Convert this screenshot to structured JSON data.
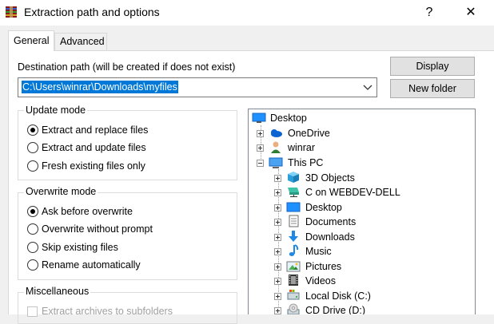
{
  "window": {
    "title": "Extraction path and options",
    "help_label": "?",
    "close_label": "✕"
  },
  "tabs": [
    {
      "label": "General",
      "active": true
    },
    {
      "label": "Advanced",
      "active": false
    }
  ],
  "destination": {
    "label": "Destination path (will be created if does not exist)",
    "value": "C:\\Users\\winrar\\Downloads\\myfiles"
  },
  "buttons": {
    "display": "Display",
    "new_folder": "New folder"
  },
  "update_mode": {
    "label": "Update mode",
    "options": [
      {
        "label": "Extract and replace files",
        "selected": true
      },
      {
        "label": "Extract and update files",
        "selected": false
      },
      {
        "label": "Fresh existing files only",
        "selected": false
      }
    ]
  },
  "overwrite_mode": {
    "label": "Overwrite mode",
    "options": [
      {
        "label": "Ask before overwrite",
        "selected": true
      },
      {
        "label": "Overwrite without prompt",
        "selected": false
      },
      {
        "label": "Skip existing files",
        "selected": false
      },
      {
        "label": "Rename automatically",
        "selected": false
      }
    ]
  },
  "miscellaneous": {
    "label": "Miscellaneous",
    "options": [
      {
        "label": "Extract archives to subfolders",
        "checked": false,
        "enabled": false
      }
    ]
  },
  "tree": [
    {
      "label": "Desktop",
      "icon": "desktop-icon",
      "expander": "none"
    },
    {
      "label": "OneDrive",
      "icon": "cloud-icon",
      "expander": "plus"
    },
    {
      "label": "winrar",
      "icon": "user-icon",
      "expander": "plus"
    },
    {
      "label": "This PC",
      "icon": "computer-icon",
      "expander": "minus"
    },
    {
      "label": "3D Objects",
      "icon": "cube-icon",
      "expander": "plus"
    },
    {
      "label": "C on WEBDEV-DELL",
      "icon": "network-drive-icon",
      "expander": "plus"
    },
    {
      "label": "Desktop",
      "icon": "desktop-icon",
      "expander": "plus"
    },
    {
      "label": "Documents",
      "icon": "documents-icon",
      "expander": "plus"
    },
    {
      "label": "Downloads",
      "icon": "downloads-icon",
      "expander": "plus"
    },
    {
      "label": "Music",
      "icon": "music-icon",
      "expander": "plus"
    },
    {
      "label": "Pictures",
      "icon": "pictures-icon",
      "expander": "plus"
    },
    {
      "label": "Videos",
      "icon": "videos-icon",
      "expander": "plus"
    },
    {
      "label": "Local Disk (C:)",
      "icon": "disk-icon",
      "expander": "plus"
    },
    {
      "label": "CD Drive (D:)",
      "icon": "cd-drive-icon",
      "expander": "plus"
    }
  ],
  "colors": {
    "selection": "#0078d7",
    "window_bg": "#f0f0f0"
  }
}
